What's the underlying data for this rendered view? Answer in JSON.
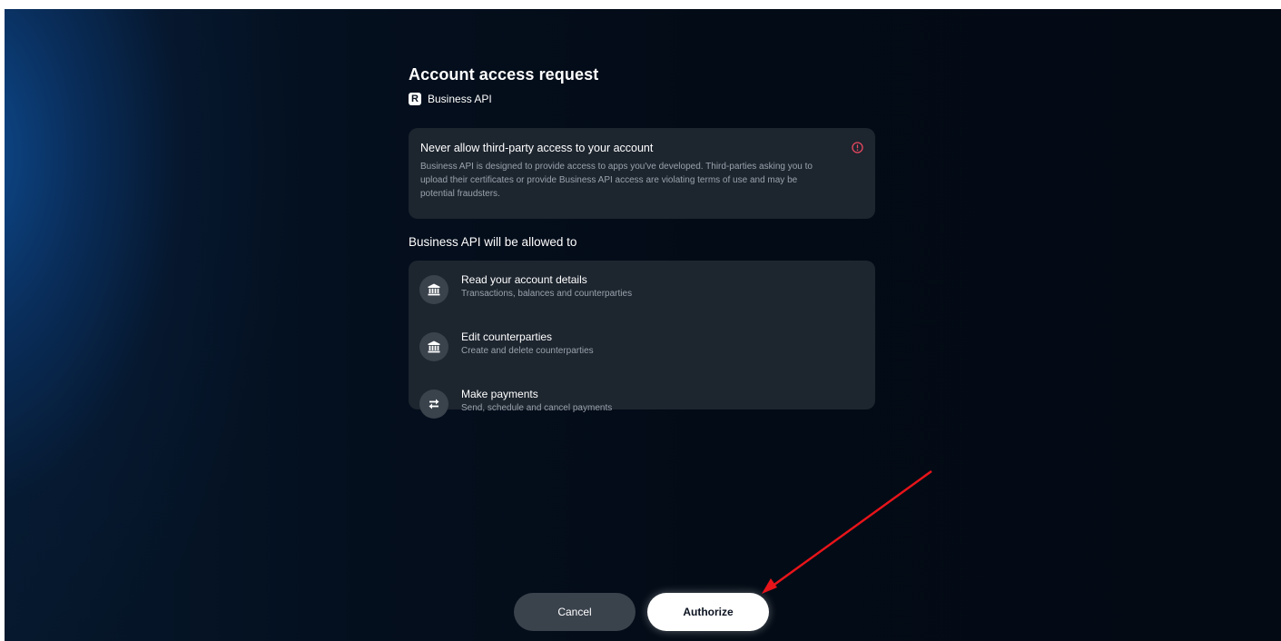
{
  "header": {
    "title": "Account access request",
    "app_logo_letter": "R",
    "app_name": "Business API"
  },
  "warning": {
    "title": "Never allow third-party access to your account",
    "text": "Business API is designed to provide access to apps you've developed. Third-parties asking you to upload their certificates or provide Business API access are violating terms of use and may be potential fraudsters.",
    "icon": "alert-circle-icon",
    "icon_color": "#e8485f"
  },
  "permissions": {
    "heading": "Business API will be allowed to",
    "items": [
      {
        "title": "Read your account details",
        "subtitle": "Transactions, balances and counterparties",
        "icon": "bank-icon"
      },
      {
        "title": "Edit counterparties",
        "subtitle": "Create and delete counterparties",
        "icon": "bank-icon"
      },
      {
        "title": "Make payments",
        "subtitle": "Send, schedule and cancel payments",
        "icon": "transfer-arrows-icon"
      }
    ]
  },
  "actions": {
    "cancel_label": "Cancel",
    "authorize_label": "Authorize"
  },
  "colors": {
    "background": "#030b16",
    "card": "#1d252f",
    "annotation_arrow": "#e8141a"
  }
}
